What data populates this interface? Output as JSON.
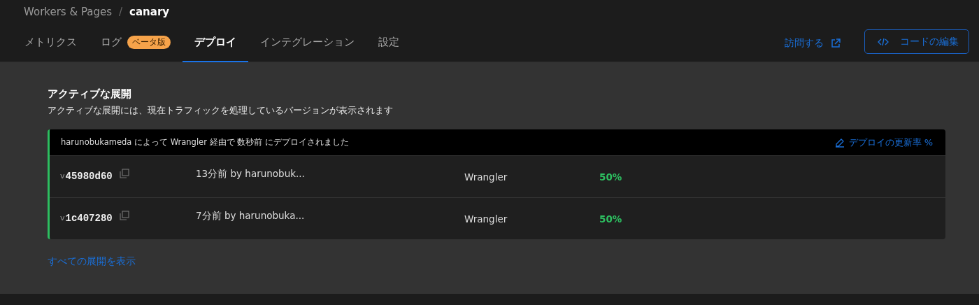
{
  "breadcrumb": {
    "parent": "Workers & Pages",
    "separator": "/",
    "current": "canary"
  },
  "tabs": [
    {
      "label": "メトリクス",
      "selected": false
    },
    {
      "label": "ログ",
      "selected": false,
      "badge": "ベータ版"
    },
    {
      "label": "デプロイ",
      "selected": true
    },
    {
      "label": "インテグレーション",
      "selected": false
    },
    {
      "label": "設定",
      "selected": false
    }
  ],
  "actions": {
    "visit": "訪問する",
    "edit_code": "コードの編集"
  },
  "section": {
    "title": "アクティブな展開",
    "description": "アクティブな展開には、現在トラフィックを処理しているバージョンが表示されます"
  },
  "deployment": {
    "summary": "harunobukameda によって Wrangler 経由で 数秒前 にデプロイされました",
    "edit_link": "デプロイの更新率 %",
    "versions": [
      {
        "prefix": "v",
        "id": "45980d60",
        "created": "13分前 by harunobuk...",
        "source": "Wrangler",
        "percentage": "50%"
      },
      {
        "prefix": "v",
        "id": "1c407280",
        "created": "7分前 by harunobuka...",
        "source": "Wrangler",
        "percentage": "50%"
      }
    ]
  },
  "view_all": "すべての展開を表示"
}
